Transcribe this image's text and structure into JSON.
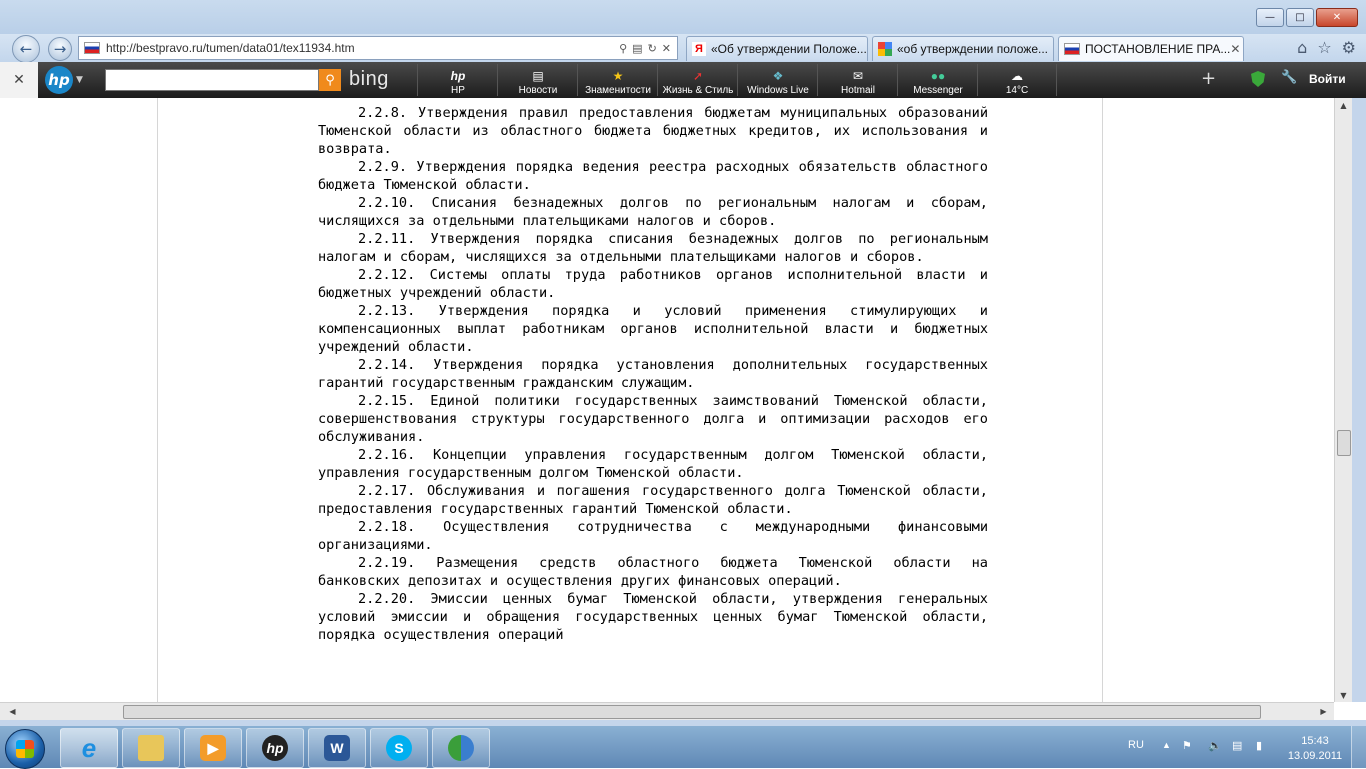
{
  "browser": {
    "address": "http://bestpravo.ru/tumen/data01/tex11934.htm",
    "tabs": [
      {
        "label": "«Об утверждении Положе..."
      },
      {
        "label": "«об утверждении положе..."
      },
      {
        "label": "ПОСТАНОВЛЕНИЕ ПРА..."
      }
    ]
  },
  "toolbar": {
    "bing_label": "bing",
    "items": [
      {
        "label": "HP",
        "icon": "hp-icon"
      },
      {
        "label": "Новости",
        "icon": "news-icon"
      },
      {
        "label": "Знаменитости",
        "icon": "star-icon"
      },
      {
        "label": "Жизнь & Стиль",
        "icon": "lifestyle-icon"
      },
      {
        "label": "Windows Live",
        "icon": "windows-live-icon"
      },
      {
        "label": "Hotmail",
        "icon": "mail-icon"
      },
      {
        "label": "Messenger",
        "icon": "messenger-icon"
      },
      {
        "label": "14°C",
        "icon": "weather-icon"
      }
    ],
    "login_label": "Войти"
  },
  "document": {
    "paragraphs": [
      "2.2.8. Утверждения правил предоставления бюджетам муниципальных образований Тюменской области из областного бюджета бюджетных кредитов, их использования и возврата.",
      "2.2.9.  Утверждения порядка ведения реестра расходных обязательств областного бюджета Тюменской области.",
      "2.2.10.  Списания безнадежных долгов по региональным налогам  и сборам, числящихся за отдельными плательщиками налогов и сборов.",
      "2.2.11.  Утверждения  порядка списания  безнадежных  долгов  по региональным налогам и сборам, числящихся за отдельными плательщиками налогов и сборов.",
      "2.2.12.  Системы оплаты труда работников органов исполнительной власти и бюджетных учреждений области.",
      "2.2.13.  Утверждения порядка и условий применения стимулирующих и  компенсационных выплат работникам органов исполнительной  власти и бюджетных учреждений области.",
      "2.2.14.  Утверждения порядка установления дополнительных государственных гарантий государственным гражданским служащим.",
      "2.2.15. Единой политики государственных заимствований Тюменской области, совершенствования структуры государственного долга  и оптимизации расходов его обслуживания.",
      "2.2.16.  Концепции управления государственным долгом  Тюменской области, управления государственным долгом Тюменской области.",
      "2.2.17.  Обслуживания и погашения государственного долга Тюменской области, предоставления государственных гарантий Тюменской области.",
      "2.2.18.  Осуществления сотрудничества с международными финансовыми организациями.",
      "2.2.19. Размещения средств областного бюджета Тюменской области на банковских депозитах и осуществления других финансовых операций.",
      "2.2.20.  Эмиссии ценных бумаг Тюменской области, утверждения генеральных условий эмиссии и обращения государственных ценных бумаг Тюменской области, порядка осуществления операций"
    ]
  },
  "taskbar": {
    "apps": [
      {
        "name": "internet-explorer-icon"
      },
      {
        "name": "file-explorer-icon"
      },
      {
        "name": "media-player-icon"
      },
      {
        "name": "hp-app-icon"
      },
      {
        "name": "word-icon"
      },
      {
        "name": "skype-icon"
      },
      {
        "name": "messenger-app-icon"
      }
    ],
    "language": "RU",
    "time": "15:43",
    "date": "13.09.2011"
  }
}
